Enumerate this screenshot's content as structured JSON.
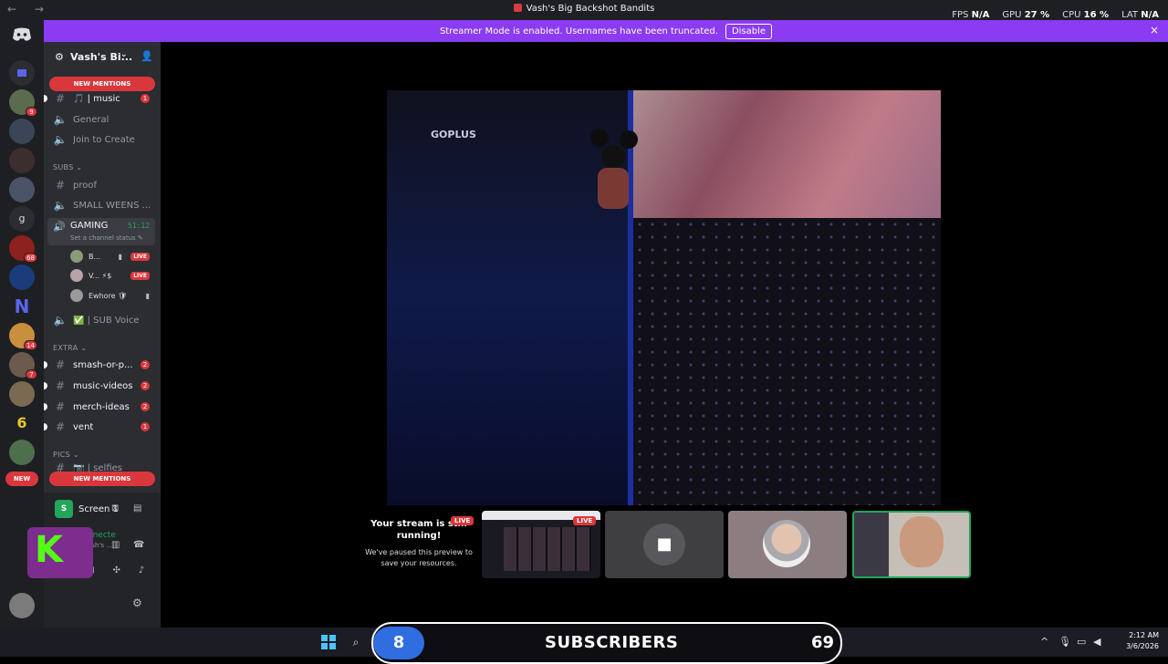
{
  "window": {
    "title": "Vash's Big Backshot Bandits",
    "nav_icons": "← →"
  },
  "stats": {
    "fps_label": "FPS",
    "fps_value": "N/A",
    "gpu_label": "GPU",
    "gpu_value": "27 %",
    "cpu_label": "CPU",
    "cpu_value": "16 %",
    "lat_label": "LAT",
    "lat_value": "N/A"
  },
  "banner": {
    "text": "Streamer Mode is enabled. Usernames have been truncated.",
    "disable_label": "Disable",
    "close_icon": "×"
  },
  "rail": {
    "servers": [
      {
        "badge": "9"
      },
      {
        "badge": ""
      },
      {
        "badge": ""
      },
      {
        "badge": ""
      },
      {
        "badge": ""
      },
      {
        "badge": "68"
      },
      {
        "badge": ""
      },
      {
        "badge": ""
      },
      {
        "badge": "14"
      },
      {
        "badge": "7"
      },
      {
        "badge": ""
      },
      {
        "badge": ""
      },
      {
        "badge": ""
      }
    ],
    "new_label": "NEW"
  },
  "server": {
    "name": "Vash's Bi...",
    "new_mentions": "NEW MENTIONS",
    "channels": {
      "music": {
        "label": "🎵 | music",
        "count": "1"
      },
      "general": "General",
      "join": "Join to Create",
      "subs_cat": "SUBS ⌄",
      "proof": "proof",
      "small": "SMALL WEENS ...",
      "gaming": "GAMING",
      "gaming_time": "51:12",
      "gaming_status": "Set a channel status ✎",
      "users": [
        {
          "name": "B...",
          "live": "LIVE"
        },
        {
          "name": "V... ⚡$",
          "live": "LIVE"
        },
        {
          "name": "Ewhore 🛡"
        }
      ],
      "subvoice": "✅ | SUB Voice",
      "extra_cat": "EXTRA ⌄",
      "extra": [
        {
          "label": "smash-or-p...",
          "count": "2"
        },
        {
          "label": "music-videos",
          "count": "2"
        },
        {
          "label": "merch-ideas",
          "count": "2"
        },
        {
          "label": "vent",
          "count": "1"
        }
      ],
      "pics_cat": "PICS ⌄",
      "selfies": "📷 | selfies"
    }
  },
  "voice": {
    "screen_label": "Screen 1",
    "connected": "Video Connecte",
    "connected_sub": "GAMING / Vash's ..."
  },
  "stream": {
    "brand_text": "GOPLUS",
    "paused_title": "Your stream is still running!",
    "paused_sub": "We've paused this preview to save your resources.",
    "live_label": "LIVE"
  },
  "overlay": {
    "count": "8",
    "label": "SUBSCRIBERS",
    "number": "69"
  },
  "taskbar": {
    "time": "2:12 AM",
    "date": "3/6/2026"
  },
  "colors": {
    "accent": "#8b3bf2",
    "live": "#da373c",
    "online": "#23a55a"
  }
}
